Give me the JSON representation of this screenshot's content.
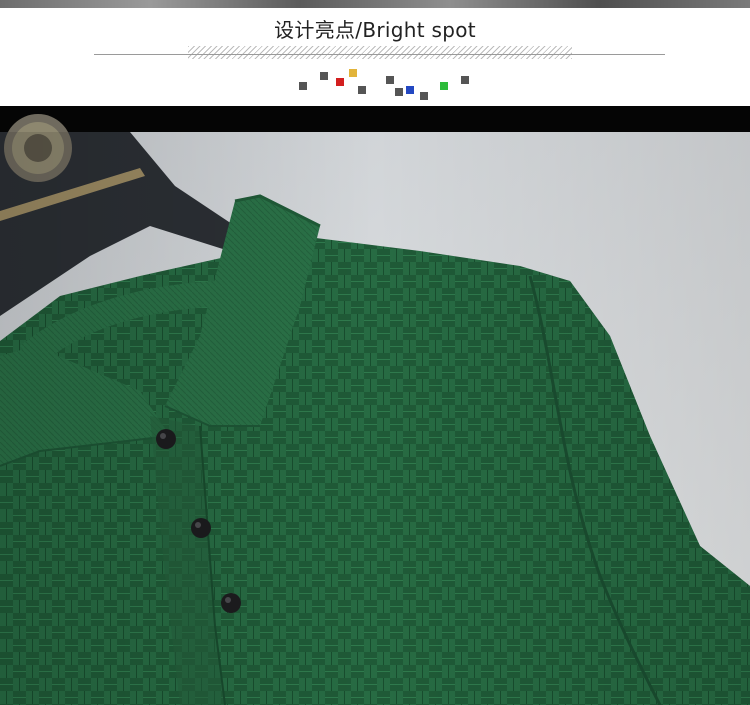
{
  "header": {
    "title": "设计亮点/Bright spot"
  },
  "decor": {
    "squares": [
      {
        "color": "#555555"
      },
      {
        "color": "#555555"
      },
      {
        "color": "#d31f1f"
      },
      {
        "color": "#e2b43a"
      },
      {
        "color": "#555555"
      },
      {
        "color": "#555555"
      },
      {
        "color": "#555555"
      },
      {
        "color": "#2348c2"
      },
      {
        "color": "#555555"
      },
      {
        "color": "#2dbb3a"
      },
      {
        "color": "#555555"
      }
    ]
  },
  "photo": {
    "subject": "green-knit-polo-shirt",
    "shirt_color": "#276b43"
  }
}
